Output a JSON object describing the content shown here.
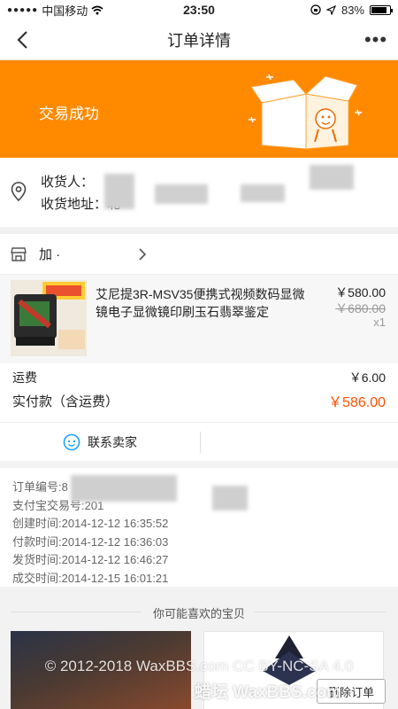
{
  "status_bar": {
    "carrier": "中国移动",
    "time": "23:50",
    "battery_text": "83%",
    "battery_level": 0.83
  },
  "nav": {
    "title": "订单详情",
    "back_icon": "chevron-left-icon",
    "more_label": "•••"
  },
  "banner": {
    "status_text": "交易成功",
    "color": "#ff8a00"
  },
  "address": {
    "recipient_label": "收货人：",
    "address_label": "收货地址：",
    "address_partial": "北"
  },
  "shop": {
    "name": "加 ·"
  },
  "product": {
    "title": "艾尼提3R-MSV35便携式视频数码显微镜电子显微镜印刷玉石翡翠鉴定",
    "price": "￥580.00",
    "original_price": "￥680.00",
    "quantity": "x1"
  },
  "fees": {
    "shipping_label": "运费",
    "shipping_value": "￥6.00",
    "total_label": "实付款（含运费）",
    "total_value": "￥586.00",
    "accent_color": "#ff5000"
  },
  "contact": {
    "label": "联系卖家"
  },
  "order_info": {
    "lines": [
      "订单编号:8",
      "支付宝交易号:201",
      "创建时间:2014-12-12 16:35:52",
      "付款时间:2014-12-12 16:36:03",
      "发货时间:2014-12-12 16:46:27",
      "成交时间:2014-12-15 16:01:21"
    ]
  },
  "recommend": {
    "title": "你可能喜欢的宝贝",
    "delete_label": "删除订单"
  },
  "watermark": {
    "line1": "© 2012-2018 WaxBBS.com  CC BY-NC-SA 4.0",
    "line2": "蜡坛 WaxBBS.com"
  }
}
